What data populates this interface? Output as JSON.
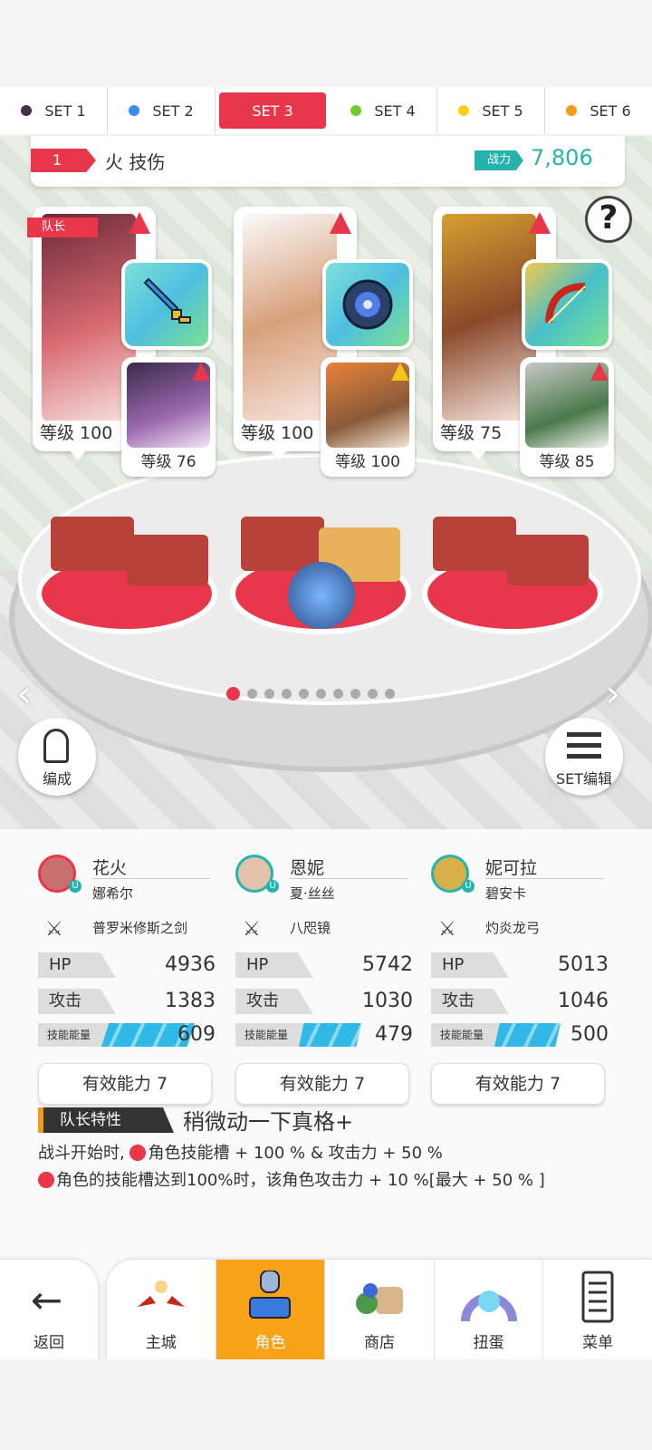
{
  "set_tabs": [
    {
      "label": "SET 1",
      "dot_color": "#4a2a4a"
    },
    {
      "label": "SET 2",
      "dot_color": "#3b8ef0"
    },
    {
      "label": "SET 3",
      "dot_color": "#e8364a",
      "active": true
    },
    {
      "label": "SET 4",
      "dot_color": "#6fcf2f"
    },
    {
      "label": "SET 5",
      "dot_color": "#f5d319"
    },
    {
      "label": "SET 6",
      "dot_color": "#f59a1b"
    }
  ],
  "team": {
    "number": "1",
    "name": "火 技伤",
    "power_label": "战力",
    "power_value": "7,806"
  },
  "help_label": "?",
  "leader_badge": "队长",
  "cards": [
    {
      "level": "等级 100",
      "sub_level": "等级 76"
    },
    {
      "level": "等级 100",
      "sub_level": "等级 100"
    },
    {
      "level": "等级 75",
      "sub_level": "等级 85"
    }
  ],
  "nav_arrows": {
    "left": "‹",
    "right": "›"
  },
  "pager": {
    "count": 10,
    "active": 0
  },
  "buttons": {
    "formation": "编成",
    "set_edit": "SET编辑"
  },
  "columns": [
    {
      "name": "花火",
      "sub": "娜希尔",
      "weapon": "普罗米修斯之剑",
      "hp": "4936",
      "atk": "1383",
      "energy": "609",
      "energy_ratio": 0.82,
      "ability": "有效能力 7"
    },
    {
      "name": "恩妮",
      "sub": "夏·丝丝",
      "weapon": "八咫镜",
      "hp": "5742",
      "atk": "1030",
      "energy": "479",
      "energy_ratio": 0.55,
      "ability": "有效能力 7"
    },
    {
      "name": "妮可拉",
      "sub": "碧安卡",
      "weapon": "灼炎龙弓",
      "hp": "5013",
      "atk": "1046",
      "energy": "500",
      "energy_ratio": 0.58,
      "ability": "有效能力 7"
    }
  ],
  "stat_labels": {
    "hp": "HP",
    "atk": "攻击",
    "energy": "技能能量"
  },
  "leader_trait": {
    "tag": "队长特性",
    "title": "稍微动一下真格+",
    "line1": "战斗开始时, ",
    "line1b": "角色技能槽 + 100 % & 攻击力 + 50 %",
    "line2": "角色的技能槽达到100%时，该角色攻击力 + 10 %[最大 + 50 % ]"
  },
  "bottom_nav": {
    "back": "返回",
    "items": [
      {
        "label": "主城",
        "icon": "castle-icon"
      },
      {
        "label": "角色",
        "icon": "character-icon",
        "active": true
      },
      {
        "label": "商店",
        "icon": "shop-icon"
      },
      {
        "label": "扭蛋",
        "icon": "gacha-icon"
      },
      {
        "label": "菜单",
        "icon": "menu-icon"
      }
    ]
  }
}
